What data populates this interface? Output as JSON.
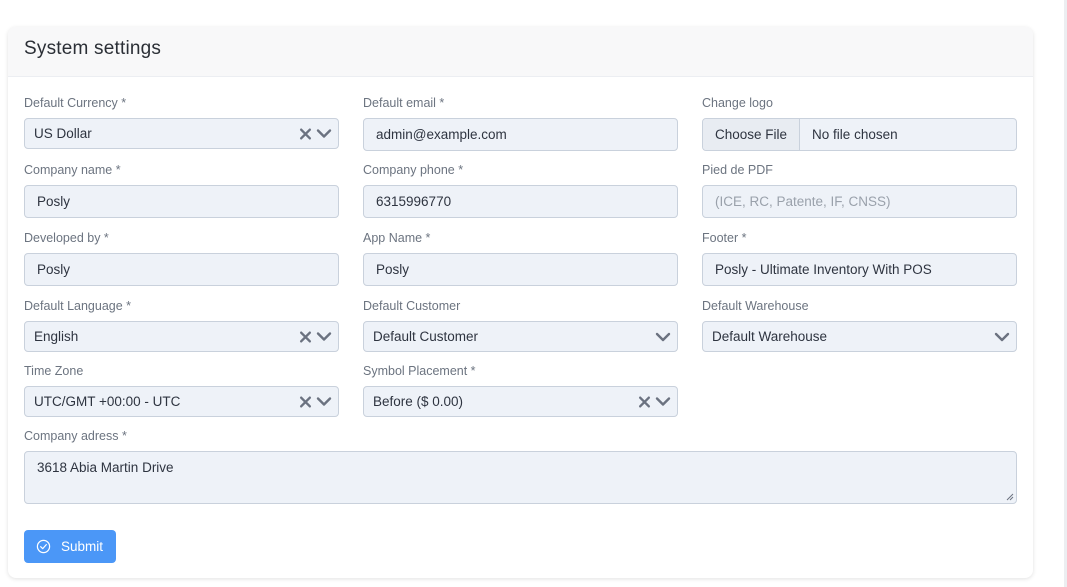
{
  "card": {
    "title": "System settings"
  },
  "fields": {
    "default_currency": {
      "label": "Default Currency *",
      "value": "US Dollar"
    },
    "default_email": {
      "label": "Default email *",
      "value": "admin@example.com"
    },
    "change_logo": {
      "label": "Change logo",
      "button": "Choose File",
      "status": "No file chosen"
    },
    "company_name": {
      "label": "Company name *",
      "value": "Posly"
    },
    "company_phone": {
      "label": "Company phone *",
      "value": "6315996770"
    },
    "pied_pdf": {
      "label": "Pied de PDF",
      "placeholder": "(ICE, RC, Patente, IF, CNSS)"
    },
    "developed_by": {
      "label": "Developed by *",
      "value": "Posly"
    },
    "app_name": {
      "label": "App Name *",
      "value": "Posly"
    },
    "footer": {
      "label": "Footer *",
      "value": "Posly - Ultimate Inventory With POS"
    },
    "default_language": {
      "label": "Default Language *",
      "value": "English"
    },
    "default_customer": {
      "label": "Default Customer",
      "value": "Default Customer"
    },
    "default_warehouse": {
      "label": "Default Warehouse",
      "value": "Default Warehouse"
    },
    "time_zone": {
      "label": "Time Zone",
      "value": "UTC/GMT +00:00 - UTC"
    },
    "symbol_placement": {
      "label": "Symbol Placement *",
      "value": "Before ($ 0.00)"
    },
    "company_address": {
      "label": "Company adress *",
      "value": "3618 Abia Martin Drive"
    }
  },
  "submit": {
    "label": "Submit"
  },
  "icons": {
    "clear": "clear-x-icon",
    "dropdown": "chevron-down-icon",
    "submit": "check-circle-icon"
  },
  "colors": {
    "primary": "#4b97f7",
    "input_bg": "#eef2f8",
    "input_border": "#c9d1dc",
    "label": "#6c7480"
  }
}
